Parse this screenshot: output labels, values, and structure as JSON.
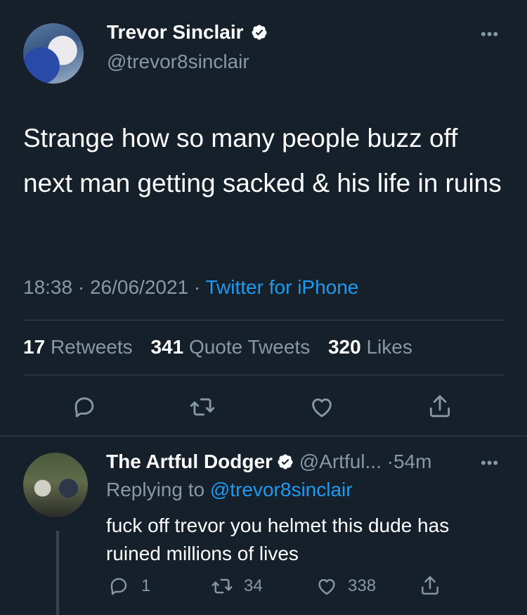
{
  "tweet": {
    "author_name": "Trevor Sinclair",
    "author_handle": "@trevor8sinclair",
    "text": "Strange how so many people buzz off next man getting sacked & his life in ruins",
    "time": "18:38",
    "date": "26/06/2021",
    "source": "Twitter for iPhone",
    "separator": "·",
    "stats": {
      "retweets_count": "17",
      "retweets_label": "Retweets",
      "quotes_count": "341",
      "quotes_label": "Quote Tweets",
      "likes_count": "320",
      "likes_label": "Likes"
    },
    "more_label": "•••"
  },
  "reply": {
    "author_name": "The Artful Dodger",
    "author_handle": "@Artful...",
    "age": "54m",
    "separator": "·",
    "replying_prefix": "Replying to",
    "replying_handle": "@trevor8sinclair",
    "text": "fuck off trevor you  helmet this dude has ruined millions of lives",
    "counts": {
      "replies": "1",
      "retweets": "34",
      "likes": "338"
    },
    "more_label": "•••"
  },
  "colors": {
    "background": "#15202b",
    "text": "#ffffff",
    "muted": "#8899a6",
    "link": "#1d9bf0",
    "divider": "#38444d"
  }
}
